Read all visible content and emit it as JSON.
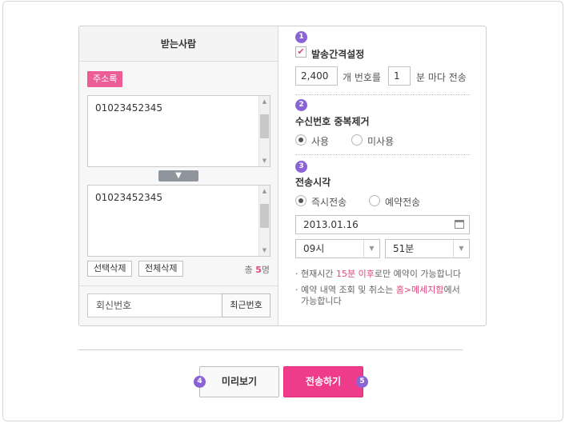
{
  "recipients": {
    "title": "받는사람",
    "address_book_label": "주소록",
    "input_numbers": "01023452345",
    "list_numbers": "01023452345",
    "delete_selected_label": "선택삭제",
    "delete_all_label": "전체삭제",
    "total_prefix": "총",
    "total_count": "5",
    "total_suffix": "명",
    "reply_number_value": "회신번호",
    "recent_numbers_label": "최근번호"
  },
  "interval": {
    "step": "1",
    "title": "발송간격설정",
    "checked": true,
    "count_value": "2,400",
    "count_suffix": "개 번호를",
    "minutes_value": "1",
    "minutes_suffix": "분 마다 전송"
  },
  "dedupe": {
    "step": "2",
    "title": "수신번호 중복제거",
    "option_use": "사용",
    "option_not_use": "미사용",
    "selected": "사용"
  },
  "send_time": {
    "step": "3",
    "title": "전송시각",
    "option_now": "즉시전송",
    "option_reserve": "예약전송",
    "selected": "즉시전송",
    "date_value": "2013.01.16",
    "hour_value": "09시",
    "minute_value": "51분",
    "note1_a": "현재시간 ",
    "note1_b": "15분 이후",
    "note1_c": "로만 예약이 가능합니다",
    "note2_a": "예약 내역 조회 및 취소는 ",
    "note2_b": "홈>메세지함",
    "note2_c": "에서",
    "note2_d": "가능합니다"
  },
  "actions": {
    "preview_step": "4",
    "preview_label": "미리보기",
    "send_step": "5",
    "send_label": "전송하기"
  },
  "colors": {
    "accent_pink": "#ee3b8a",
    "step_purple": "#8a64d6"
  }
}
